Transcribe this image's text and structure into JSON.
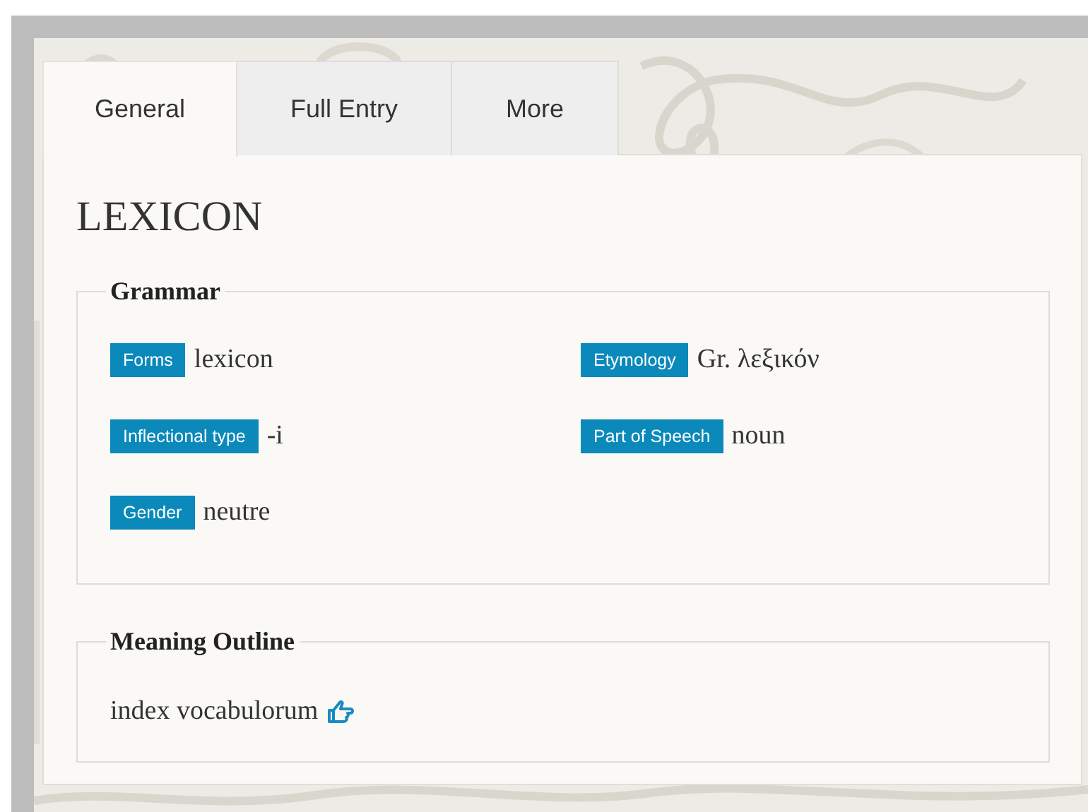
{
  "tabs": [
    {
      "label": "General",
      "selected": true
    },
    {
      "label": "Full Entry",
      "selected": false
    },
    {
      "label": "More",
      "selected": false
    }
  ],
  "title": "LEXICON",
  "grammar": {
    "legend": "Grammar",
    "fields": [
      {
        "label": "Forms",
        "value": "lexicon"
      },
      {
        "label": "Etymology",
        "value": "Gr. λεξικόν"
      },
      {
        "label": "Inflectional type",
        "value": "-i"
      },
      {
        "label": "Part of Speech",
        "value": "noun"
      },
      {
        "label": "Gender",
        "value": "neutre"
      }
    ]
  },
  "meaning_outline": {
    "legend": "Meaning Outline",
    "items": [
      {
        "text": "index vocabulorum"
      }
    ]
  }
}
